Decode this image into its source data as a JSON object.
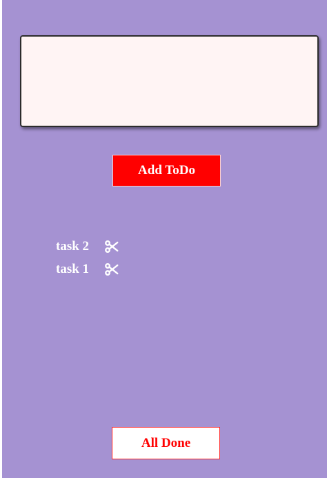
{
  "input": {
    "value": "",
    "placeholder": ""
  },
  "add_button": {
    "label": "Add ToDo"
  },
  "todos": [
    {
      "label": "task 2",
      "icon": "scissors-icon"
    },
    {
      "label": "task 1",
      "icon": "scissors-icon"
    }
  ],
  "done_button": {
    "label": "All Done"
  },
  "colors": {
    "background": "#a592d2",
    "input_bg": "#fff4f4",
    "accent": "#ff0000",
    "text_light": "#ffffff"
  }
}
